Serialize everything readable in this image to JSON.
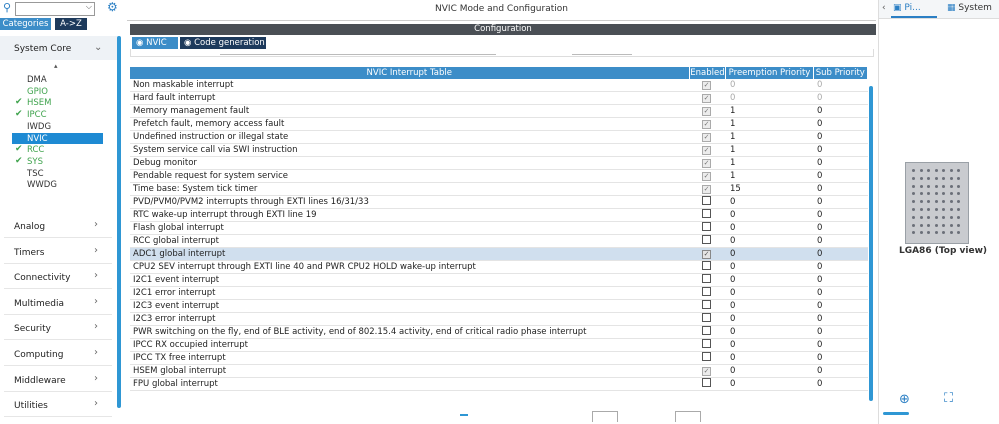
{
  "left": {
    "search": {
      "value": ""
    },
    "tabs": [
      "Categories",
      "A->Z"
    ],
    "section_title": "System Core",
    "items": [
      {
        "label": "DMA",
        "checked": false,
        "color": "#333333",
        "selected": false
      },
      {
        "label": "GPIO",
        "checked": false,
        "color": "#3fa34d",
        "selected": false
      },
      {
        "label": "HSEM",
        "checked": true,
        "color": "#3fa34d",
        "selected": false
      },
      {
        "label": "IPCC",
        "checked": true,
        "color": "#3fa34d",
        "selected": false
      },
      {
        "label": "IWDG",
        "checked": false,
        "color": "#333333",
        "selected": false
      },
      {
        "label": "NVIC",
        "checked": false,
        "color": "#ffffff",
        "selected": true
      },
      {
        "label": "RCC",
        "checked": true,
        "color": "#3fa34d",
        "selected": false
      },
      {
        "label": "SYS",
        "checked": true,
        "color": "#3fa34d",
        "selected": false
      },
      {
        "label": "TSC",
        "checked": false,
        "color": "#333333",
        "selected": false
      },
      {
        "label": "WWDG",
        "checked": false,
        "color": "#333333",
        "selected": false
      }
    ],
    "sections": [
      "Analog",
      "Timers",
      "Connectivity",
      "Multimedia",
      "Security",
      "Computing",
      "Middleware",
      "Utilities"
    ]
  },
  "center": {
    "title": "NVIC Mode and Configuration",
    "config_bar": "Configuration",
    "tabs": [
      "NVIC",
      "Code generation"
    ],
    "table": {
      "headers": [
        "NVIC Interrupt Table",
        "Enabled",
        "Preemption Priority",
        "Sub Priority"
      ],
      "rows": [
        {
          "name": "Non maskable interrupt",
          "enabled": true,
          "locked": true,
          "pre": "0",
          "sub": "0",
          "dim": true
        },
        {
          "name": "Hard fault interrupt",
          "enabled": true,
          "locked": true,
          "pre": "0",
          "sub": "0",
          "dim": true
        },
        {
          "name": "Memory management fault",
          "enabled": true,
          "locked": true,
          "pre": "1",
          "sub": "0",
          "dim": false
        },
        {
          "name": "Prefetch fault, memory access fault",
          "enabled": true,
          "locked": true,
          "pre": "1",
          "sub": "0",
          "dim": false
        },
        {
          "name": "Undefined instruction or illegal state",
          "enabled": true,
          "locked": true,
          "pre": "1",
          "sub": "0",
          "dim": false
        },
        {
          "name": "System service call via SWI instruction",
          "enabled": true,
          "locked": true,
          "pre": "1",
          "sub": "0",
          "dim": false
        },
        {
          "name": "Debug monitor",
          "enabled": true,
          "locked": true,
          "pre": "1",
          "sub": "0",
          "dim": false
        },
        {
          "name": "Pendable request for system service",
          "enabled": true,
          "locked": true,
          "pre": "1",
          "sub": "0",
          "dim": false
        },
        {
          "name": "Time base: System tick timer",
          "enabled": true,
          "locked": true,
          "pre": "15",
          "sub": "0",
          "dim": false
        },
        {
          "name": "PVD/PVM0/PVM2 interrupts through EXTI lines 16/31/33",
          "enabled": false,
          "locked": false,
          "pre": "0",
          "sub": "0",
          "dim": false
        },
        {
          "name": "RTC wake-up interrupt through EXTI line 19",
          "enabled": false,
          "locked": false,
          "pre": "0",
          "sub": "0",
          "dim": false
        },
        {
          "name": "Flash global interrupt",
          "enabled": false,
          "locked": false,
          "pre": "0",
          "sub": "0",
          "dim": false
        },
        {
          "name": "RCC global interrupt",
          "enabled": false,
          "locked": false,
          "pre": "0",
          "sub": "0",
          "dim": false
        },
        {
          "name": "ADC1 global interrupt",
          "enabled": true,
          "locked": false,
          "pre": "0",
          "sub": "0",
          "dim": false,
          "selected": true
        },
        {
          "name": "CPU2 SEV interrupt through EXTI line 40 and PWR CPU2 HOLD wake-up interrupt",
          "enabled": false,
          "locked": false,
          "pre": "0",
          "sub": "0",
          "dim": false
        },
        {
          "name": "I2C1 event interrupt",
          "enabled": false,
          "locked": false,
          "pre": "0",
          "sub": "0",
          "dim": false
        },
        {
          "name": "I2C1 error interrupt",
          "enabled": false,
          "locked": false,
          "pre": "0",
          "sub": "0",
          "dim": false
        },
        {
          "name": "I2C3 event interrupt",
          "enabled": false,
          "locked": false,
          "pre": "0",
          "sub": "0",
          "dim": false
        },
        {
          "name": "I2C3 error interrupt",
          "enabled": false,
          "locked": false,
          "pre": "0",
          "sub": "0",
          "dim": false
        },
        {
          "name": "PWR switching on the fly, end of BLE activity, end of 802.15.4 activity, end of critical radio phase interrupt",
          "enabled": false,
          "locked": false,
          "pre": "0",
          "sub": "0",
          "dim": false
        },
        {
          "name": "IPCC RX occupied interrupt",
          "enabled": false,
          "locked": false,
          "pre": "0",
          "sub": "0",
          "dim": false
        },
        {
          "name": "IPCC TX free interrupt",
          "enabled": false,
          "locked": false,
          "pre": "0",
          "sub": "0",
          "dim": false
        },
        {
          "name": "HSEM global interrupt",
          "enabled": true,
          "locked": true,
          "pre": "0",
          "sub": "0",
          "dim": false
        },
        {
          "name": "FPU global interrupt",
          "enabled": false,
          "locked": false,
          "pre": "0",
          "sub": "0",
          "dim": false
        }
      ]
    }
  },
  "right": {
    "tabs": [
      "Pi...",
      "System"
    ],
    "chip_label": "LGA86 (Top view)"
  },
  "colors": {
    "accent": "#3c8dc8",
    "tab_dark": "#1d3a5c",
    "scrollbar": "#2f97d4",
    "selected_row": "#d0dfee"
  }
}
